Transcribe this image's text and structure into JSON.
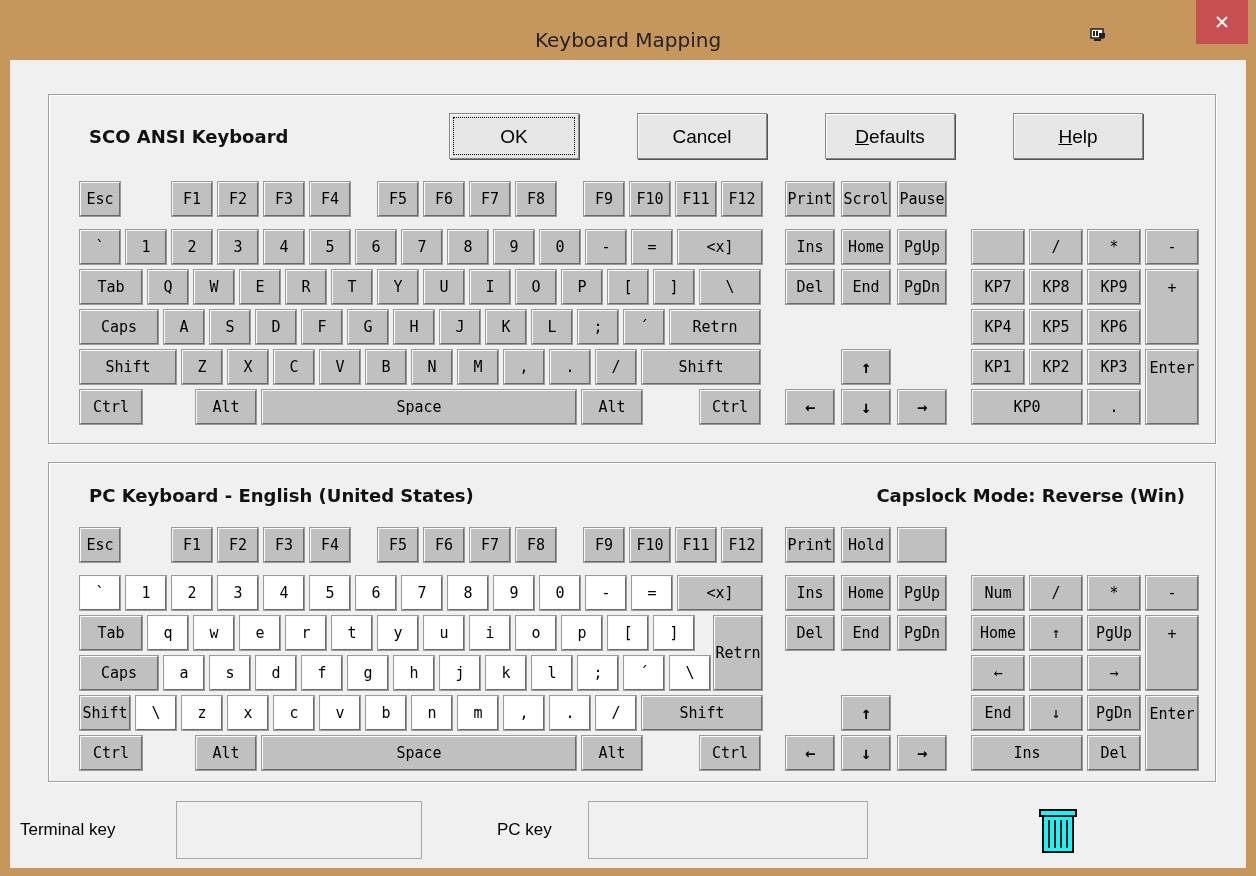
{
  "window": {
    "title": "Keyboard Mapping"
  },
  "buttons": [
    {
      "label": "OK",
      "focused": true,
      "mnemonic": false
    },
    {
      "label": "Cancel",
      "focused": false,
      "mnemonic": false
    },
    {
      "label": "Defaults",
      "focused": false,
      "mnemonic": true
    },
    {
      "label": "Help",
      "focused": false,
      "mnemonic": true
    }
  ],
  "keyboards": [
    {
      "title": "SCO ANSI Keyboard",
      "main_rows": [
        [
          {
            "label": "Esc",
            "highlighted": false
          },
          {
            "label": "F1",
            "highlighted": false
          },
          {
            "label": "F2",
            "highlighted": false
          },
          {
            "label": "F3",
            "highlighted": false
          },
          {
            "label": "F4",
            "highlighted": false
          },
          {
            "label": "F5",
            "highlighted": false
          },
          {
            "label": "F6",
            "highlighted": false
          },
          {
            "label": "F7",
            "highlighted": false
          },
          {
            "label": "F8",
            "highlighted": false
          },
          {
            "label": "F9",
            "highlighted": false
          },
          {
            "label": "F10",
            "highlighted": false
          },
          {
            "label": "F11",
            "highlighted": false
          },
          {
            "label": "F12",
            "highlighted": false
          }
        ],
        [
          {
            "label": "`",
            "highlighted": false
          },
          {
            "label": "1",
            "highlighted": false
          },
          {
            "label": "2",
            "highlighted": false
          },
          {
            "label": "3",
            "highlighted": false
          },
          {
            "label": "4",
            "highlighted": false
          },
          {
            "label": "5",
            "highlighted": false
          },
          {
            "label": "6",
            "highlighted": false
          },
          {
            "label": "7",
            "highlighted": false
          },
          {
            "label": "8",
            "highlighted": false
          },
          {
            "label": "9",
            "highlighted": false
          },
          {
            "label": "0",
            "highlighted": false
          },
          {
            "label": "-",
            "highlighted": false
          },
          {
            "label": "=",
            "highlighted": false
          },
          {
            "label": "<x]",
            "highlighted": false
          }
        ],
        [
          {
            "label": "Tab",
            "highlighted": false
          },
          {
            "label": "Q",
            "highlighted": false
          },
          {
            "label": "W",
            "highlighted": false
          },
          {
            "label": "E",
            "highlighted": false
          },
          {
            "label": "R",
            "highlighted": false
          },
          {
            "label": "T",
            "highlighted": false
          },
          {
            "label": "Y",
            "highlighted": false
          },
          {
            "label": "U",
            "highlighted": false
          },
          {
            "label": "I",
            "highlighted": false
          },
          {
            "label": "O",
            "highlighted": false
          },
          {
            "label": "P",
            "highlighted": false
          },
          {
            "label": "[",
            "highlighted": false
          },
          {
            "label": "]",
            "highlighted": false
          },
          {
            "label": "\\",
            "highlighted": false
          }
        ],
        [
          {
            "label": "Caps",
            "highlighted": false
          },
          {
            "label": "A",
            "highlighted": false
          },
          {
            "label": "S",
            "highlighted": false
          },
          {
            "label": "D",
            "highlighted": false
          },
          {
            "label": "F",
            "highlighted": false
          },
          {
            "label": "G",
            "highlighted": false
          },
          {
            "label": "H",
            "highlighted": false
          },
          {
            "label": "J",
            "highlighted": false
          },
          {
            "label": "K",
            "highlighted": false
          },
          {
            "label": "L",
            "highlighted": false
          },
          {
            "label": ";",
            "highlighted": false
          },
          {
            "label": "´",
            "highlighted": false
          },
          {
            "label": "Retrn",
            "highlighted": false
          }
        ],
        [
          {
            "label": "Shift",
            "highlighted": false
          },
          {
            "label": "Z",
            "highlighted": false
          },
          {
            "label": "X",
            "highlighted": false
          },
          {
            "label": "C",
            "highlighted": false
          },
          {
            "label": "V",
            "highlighted": false
          },
          {
            "label": "B",
            "highlighted": false
          },
          {
            "label": "N",
            "highlighted": false
          },
          {
            "label": "M",
            "highlighted": false
          },
          {
            "label": ",",
            "highlighted": false
          },
          {
            "label": ".",
            "highlighted": false
          },
          {
            "label": "/",
            "highlighted": false
          },
          {
            "label": "Shift",
            "highlighted": false
          }
        ],
        [
          {
            "label": "Ctrl",
            "highlighted": false
          },
          {
            "label": "Alt",
            "highlighted": false
          },
          {
            "label": "Space",
            "highlighted": false
          },
          {
            "label": "Alt",
            "highlighted": false
          },
          {
            "label": "Ctrl",
            "highlighted": false
          }
        ]
      ],
      "system_keys": [
        {
          "label": "Print",
          "highlighted": false
        },
        {
          "label": "Scrol",
          "highlighted": false
        },
        {
          "label": "Pause",
          "highlighted": false
        }
      ],
      "nav_keys": [
        {
          "label": "Ins",
          "highlighted": false
        },
        {
          "label": "Home",
          "highlighted": false
        },
        {
          "label": "PgUp",
          "highlighted": false
        },
        {
          "label": "Del",
          "highlighted": false
        },
        {
          "label": "End",
          "highlighted": false
        },
        {
          "label": "PgDn",
          "highlighted": false
        }
      ],
      "arrow_keys": [
        {
          "label": "↑",
          "highlighted": false
        },
        {
          "label": "←",
          "highlighted": false
        },
        {
          "label": "↓",
          "highlighted": false
        },
        {
          "label": "→",
          "highlighted": false
        }
      ],
      "keypad": [
        {
          "highlighted": false
        },
        {
          "label": "/",
          "highlighted": false
        },
        {
          "label": "*",
          "highlighted": false
        },
        {
          "label": "-",
          "highlighted": false
        },
        {
          "label": "KP7",
          "highlighted": false
        },
        {
          "label": "KP8",
          "highlighted": false
        },
        {
          "label": "KP9",
          "highlighted": false
        },
        {
          "label": "+",
          "highlighted": false
        },
        {
          "label": "KP4",
          "highlighted": false
        },
        {
          "label": "KP5",
          "highlighted": false
        },
        {
          "label": "KP6",
          "highlighted": false
        },
        {
          "label": "KP1",
          "highlighted": false
        },
        {
          "label": "KP2",
          "highlighted": false
        },
        {
          "label": "KP3",
          "highlighted": false
        },
        {
          "label": "Enter",
          "highlighted": false
        },
        {
          "label": "KP0",
          "highlighted": false
        },
        {
          "label": ".",
          "highlighted": false
        }
      ]
    },
    {
      "title": "PC Keyboard - English (United States)",
      "caption": "Capslock Mode: Reverse (Win)",
      "main_rows": [
        [
          {
            "label": "Esc",
            "highlighted": false
          },
          {
            "label": "F1",
            "highlighted": false
          },
          {
            "label": "F2",
            "highlighted": false
          },
          {
            "label": "F3",
            "highlighted": false
          },
          {
            "label": "F4",
            "highlighted": false
          },
          {
            "label": "F5",
            "highlighted": false
          },
          {
            "label": "F6",
            "highlighted": false
          },
          {
            "label": "F7",
            "highlighted": false
          },
          {
            "label": "F8",
            "highlighted": false
          },
          {
            "label": "F9",
            "highlighted": false
          },
          {
            "label": "F10",
            "highlighted": false
          },
          {
            "label": "F11",
            "highlighted": false
          },
          {
            "label": "F12",
            "highlighted": false
          }
        ],
        [
          {
            "label": "`",
            "highlighted": true
          },
          {
            "label": "1",
            "highlighted": true
          },
          {
            "label": "2",
            "highlighted": true
          },
          {
            "label": "3",
            "highlighted": true
          },
          {
            "label": "4",
            "highlighted": true
          },
          {
            "label": "5",
            "highlighted": true
          },
          {
            "label": "6",
            "highlighted": true
          },
          {
            "label": "7",
            "highlighted": true
          },
          {
            "label": "8",
            "highlighted": true
          },
          {
            "label": "9",
            "highlighted": true
          },
          {
            "label": "0",
            "highlighted": true
          },
          {
            "label": "-",
            "highlighted": true
          },
          {
            "label": "=",
            "highlighted": true
          },
          {
            "label": "<x]",
            "highlighted": false
          }
        ],
        [
          {
            "label": "Tab",
            "highlighted": false
          },
          {
            "label": "q",
            "highlighted": true
          },
          {
            "label": "w",
            "highlighted": true
          },
          {
            "label": "e",
            "highlighted": true
          },
          {
            "label": "r",
            "highlighted": true
          },
          {
            "label": "t",
            "highlighted": true
          },
          {
            "label": "y",
            "highlighted": true
          },
          {
            "label": "u",
            "highlighted": true
          },
          {
            "label": "i",
            "highlighted": true
          },
          {
            "label": "o",
            "highlighted": true
          },
          {
            "label": "p",
            "highlighted": true
          },
          {
            "label": "[",
            "highlighted": true
          },
          {
            "label": "]",
            "highlighted": true
          },
          {
            "label": "Retrn",
            "highlighted": false
          }
        ],
        [
          {
            "label": "Caps",
            "highlighted": false
          },
          {
            "label": "a",
            "highlighted": true
          },
          {
            "label": "s",
            "highlighted": true
          },
          {
            "label": "d",
            "highlighted": true
          },
          {
            "label": "f",
            "highlighted": true
          },
          {
            "label": "g",
            "highlighted": true
          },
          {
            "label": "h",
            "highlighted": true
          },
          {
            "label": "j",
            "highlighted": true
          },
          {
            "label": "k",
            "highlighted": true
          },
          {
            "label": "l",
            "highlighted": true
          },
          {
            "label": ";",
            "highlighted": true
          },
          {
            "label": "´",
            "highlighted": true
          },
          {
            "label": "\\",
            "highlighted": true
          }
        ],
        [
          {
            "label": "Shift",
            "highlighted": false
          },
          {
            "label": "\\",
            "highlighted": true
          },
          {
            "label": "z",
            "highlighted": true
          },
          {
            "label": "x",
            "highlighted": true
          },
          {
            "label": "c",
            "highlighted": true
          },
          {
            "label": "v",
            "highlighted": true
          },
          {
            "label": "b",
            "highlighted": true
          },
          {
            "label": "n",
            "highlighted": true
          },
          {
            "label": "m",
            "highlighted": true
          },
          {
            "label": ",",
            "highlighted": true
          },
          {
            "label": ".",
            "highlighted": true
          },
          {
            "label": "/",
            "highlighted": true
          },
          {
            "label": "Shift",
            "highlighted": false
          }
        ],
        [
          {
            "label": "Ctrl",
            "highlighted": false
          },
          {
            "label": "Alt",
            "highlighted": false
          },
          {
            "label": "Space",
            "highlighted": false
          },
          {
            "label": "Alt",
            "highlighted": false
          },
          {
            "label": "Ctrl",
            "highlighted": false
          }
        ]
      ],
      "system_keys": [
        {
          "label": "Print",
          "highlighted": false
        },
        {
          "label": "Hold",
          "highlighted": false
        },
        {
          "highlighted": false
        }
      ],
      "nav_keys": [
        {
          "label": "Ins",
          "highlighted": false
        },
        {
          "label": "Home",
          "highlighted": false
        },
        {
          "label": "PgUp",
          "highlighted": false
        },
        {
          "label": "Del",
          "highlighted": false
        },
        {
          "label": "End",
          "highlighted": false
        },
        {
          "label": "PgDn",
          "highlighted": false
        }
      ],
      "arrow_keys": [
        {
          "label": "↑",
          "highlighted": false
        },
        {
          "label": "←",
          "highlighted": false
        },
        {
          "label": "↓",
          "highlighted": false
        },
        {
          "label": "→",
          "highlighted": false
        }
      ],
      "keypad": [
        {
          "label": "Num",
          "highlighted": false
        },
        {
          "label": "/",
          "highlighted": false
        },
        {
          "label": "*",
          "highlighted": false
        },
        {
          "label": "-",
          "highlighted": false
        },
        {
          "label": "Home",
          "highlighted": false
        },
        {
          "label": "↑",
          "highlighted": false
        },
        {
          "label": "PgUp",
          "highlighted": false
        },
        {
          "label": "+",
          "highlighted": false
        },
        {
          "label": "←",
          "highlighted": false
        },
        {
          "highlighted": false
        },
        {
          "label": "→",
          "highlighted": false
        },
        {
          "label": "End",
          "highlighted": false
        },
        {
          "label": "↓",
          "highlighted": false
        },
        {
          "label": "PgDn",
          "highlighted": false
        },
        {
          "label": "Enter",
          "highlighted": false
        },
        {
          "label": "Ins",
          "highlighted": false
        },
        {
          "label": "Del",
          "highlighted": false
        }
      ]
    }
  ],
  "footer": {
    "terminal_key": {
      "label": "Terminal key"
    },
    "pc_key": {
      "label": "PC key"
    }
  }
}
